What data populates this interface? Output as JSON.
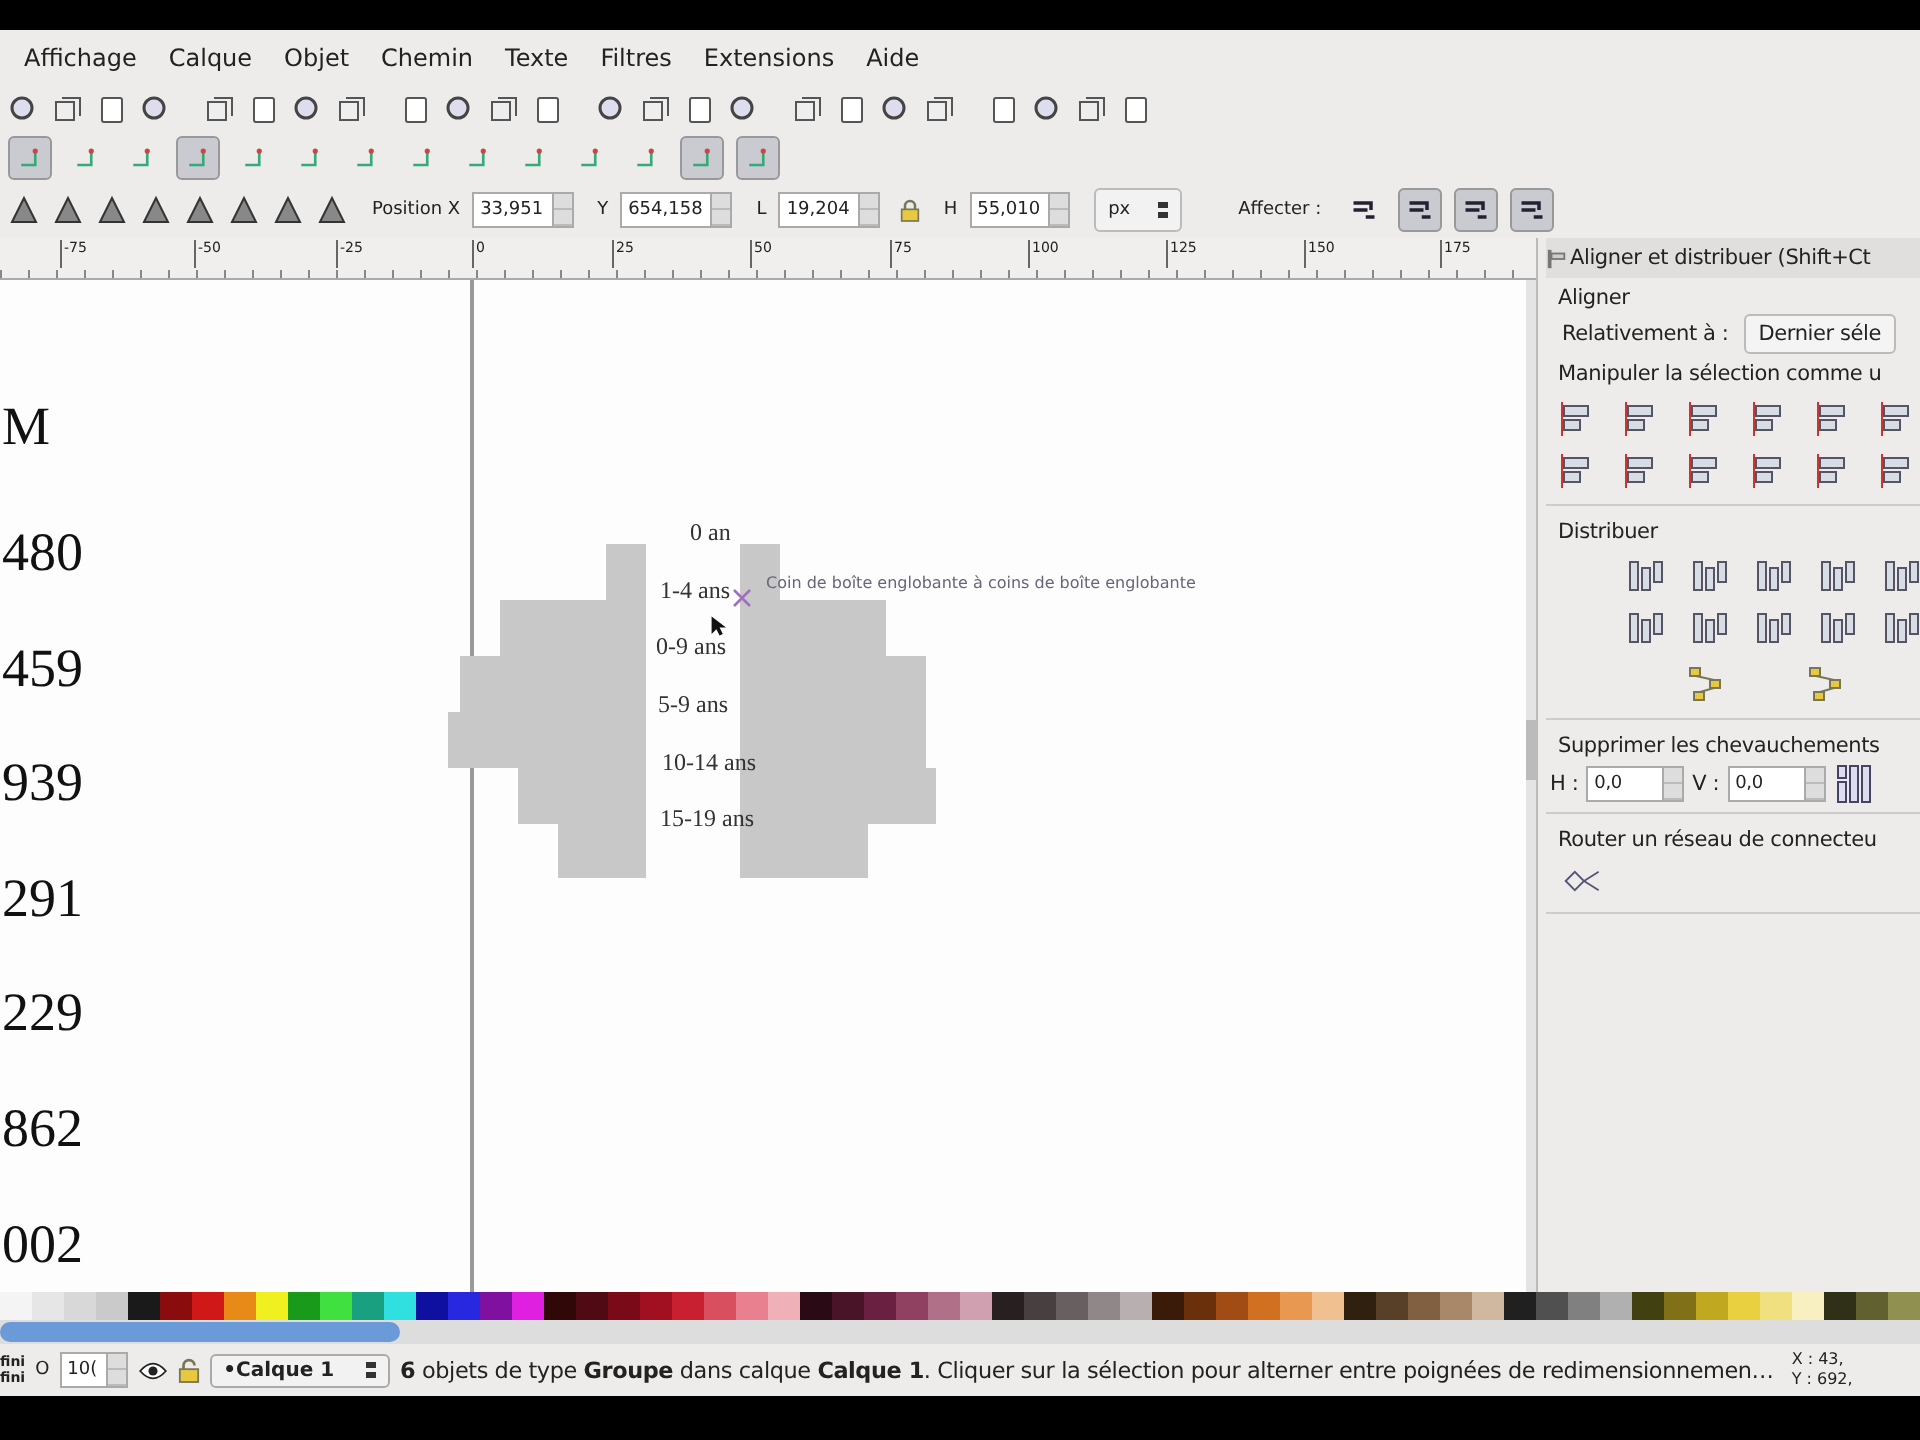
{
  "menu": [
    {
      "label": "Affichage"
    },
    {
      "label": "Calque"
    },
    {
      "label": "Objet"
    },
    {
      "label": "Chemin"
    },
    {
      "label": "Texte"
    },
    {
      "label": "Filtres"
    },
    {
      "label": "Extensions"
    },
    {
      "label": "Aide"
    }
  ],
  "snap_toolbar": [
    {
      "pressed": true
    },
    {
      "pressed": false
    },
    {
      "pressed": false
    },
    {
      "pressed": true
    },
    {
      "pressed": false
    },
    {
      "pressed": false
    },
    {
      "pressed": false
    },
    {
      "pressed": false
    },
    {
      "pressed": false
    },
    {
      "pressed": false
    },
    {
      "pressed": false
    },
    {
      "pressed": false
    },
    {
      "pressed": true
    },
    {
      "pressed": true
    }
  ],
  "selector_toolbar": {
    "fields": [
      {
        "label": "Position X",
        "value": "33,951"
      },
      {
        "label": "Y",
        "value": "654,158"
      },
      {
        "label": "L",
        "value": "19,204"
      },
      {
        "label": "H",
        "value": "55,010"
      }
    ],
    "unit": "px",
    "affect_label": "Affecter :",
    "affect_buttons": [
      {
        "pressed": false
      },
      {
        "pressed": true
      },
      {
        "pressed": true
      },
      {
        "pressed": true
      }
    ]
  },
  "ruler": [
    "-75",
    "-50",
    "-25",
    "0",
    "25",
    "50",
    "75",
    "100",
    "125",
    "150",
    "175"
  ],
  "canvas": {
    "column_texts": [
      "M",
      "480",
      "459",
      "939",
      "291",
      "229",
      "862",
      "002"
    ],
    "pyramid_labels": [
      "0 an",
      "1-4 ans",
      "0-9 ans",
      "5-9 ans",
      "10-14 ans",
      "15-19 ans"
    ],
    "snap_tooltip": "Coin de boîte englobante à coins de boîte englobante"
  },
  "panel": {
    "title": "Aligner et distribuer (Shift+Ct",
    "align_heading": "Aligner",
    "relative_label": "Relativement à :",
    "relative_value": "Dernier séle",
    "group_label": "Manipuler la sélection comme u",
    "distribute_heading": "Distribuer",
    "overlap_heading": "Supprimer les chevauchements",
    "h_label": "H :",
    "h_value": "0,0",
    "v_label": "V :",
    "v_value": "0,0",
    "connector_heading": "Router un réseau de connecteu"
  },
  "palette": [
    {
      "color": "#f4f4f4"
    },
    {
      "color": "#e6e6e6"
    },
    {
      "color": "#d8d8d8"
    },
    {
      "color": "#cacaca"
    },
    {
      "color": "#1a1a1a"
    },
    {
      "color": "#8a0c0c"
    },
    {
      "color": "#d01818"
    },
    {
      "color": "#e88a18"
    },
    {
      "color": "#f0f020"
    },
    {
      "color": "#1a9a1a"
    },
    {
      "color": "#40e040"
    },
    {
      "color": "#18a080"
    },
    {
      "color": "#30e0e0"
    },
    {
      "color": "#1010a0"
    },
    {
      "color": "#2828e0"
    },
    {
      "color": "#8010a0"
    },
    {
      "color": "#e020e0"
    },
    {
      "color": "#300808"
    },
    {
      "color": "#500a14"
    },
    {
      "color": "#7a0a18"
    },
    {
      "color": "#a01020"
    },
    {
      "color": "#c82030"
    },
    {
      "color": "#d85060"
    },
    {
      "color": "#e88090"
    },
    {
      "color": "#f0b0b8"
    },
    {
      "color": "#2a0a14"
    },
    {
      "color": "#4a1428"
    },
    {
      "color": "#6a2040"
    },
    {
      "color": "#904060"
    },
    {
      "color": "#b07088"
    },
    {
      "color": "#d0a0b0"
    },
    {
      "color": "#282020"
    },
    {
      "color": "#484040"
    },
    {
      "color": "#686060"
    },
    {
      "color": "#908888"
    },
    {
      "color": "#b8b0b0"
    },
    {
      "color": "#3a1a08"
    },
    {
      "color": "#6a300c"
    },
    {
      "color": "#a04c14"
    },
    {
      "color": "#d07020"
    },
    {
      "color": "#e89850"
    },
    {
      "color": "#f0c090"
    },
    {
      "color": "#302010"
    },
    {
      "color": "#584028"
    },
    {
      "color": "#806040"
    },
    {
      "color": "#a88868"
    },
    {
      "color": "#d0b8a0"
    },
    {
      "color": "#202020"
    },
    {
      "color": "#505050"
    },
    {
      "color": "#808080"
    },
    {
      "color": "#b0b0b0"
    },
    {
      "color": "#404010"
    },
    {
      "color": "#807018"
    },
    {
      "color": "#c0a820"
    },
    {
      "color": "#e8d040"
    },
    {
      "color": "#f0e080"
    },
    {
      "color": "#f8f0c0"
    },
    {
      "color": "#303018"
    },
    {
      "color": "#606030"
    },
    {
      "color": "#909050"
    }
  ],
  "status": {
    "left_top": "fini",
    "left_bottom": "fini",
    "opacity_label": "O",
    "opacity_value": "10(",
    "layer": "•Calque 1",
    "message": "**6** objets de type **Groupe** dans calque **Calque 1**. Cliquer sur la sélection pour alterner entre poignées de redimensionnemen…",
    "x_label": "X :",
    "x_value": "43,",
    "y_label": "Y :",
    "y_value": "692,"
  }
}
